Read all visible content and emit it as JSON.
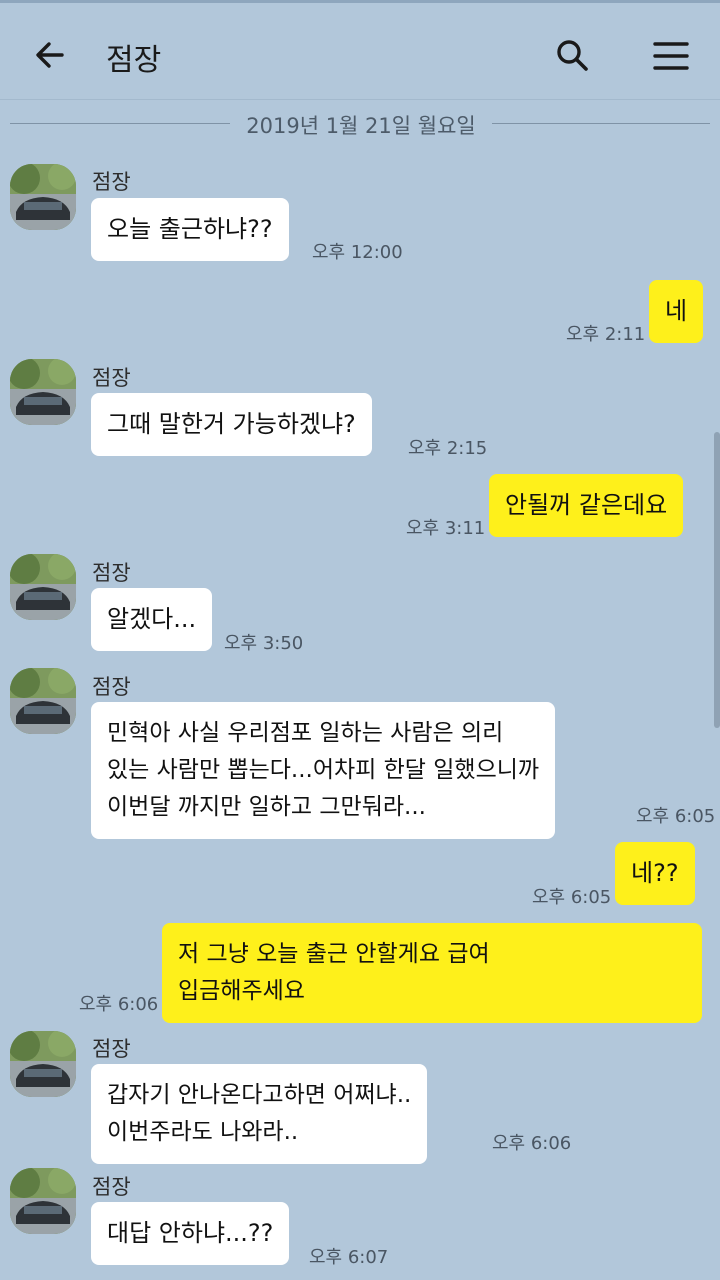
{
  "header": {
    "title": "점장",
    "back_icon": "arrow-left-icon",
    "search_icon": "search-icon",
    "menu_icon": "hamburger-menu-icon"
  },
  "date_divider": "2019년 1월 21일 월요일",
  "colors": {
    "background": "#b2c7da",
    "incoming_bubble": "#ffffff",
    "outgoing_bubble": "#fef01b"
  },
  "messages": [
    {
      "sender": "점장",
      "text": "오늘 출근하냐??",
      "time": "오후 12:00"
    },
    {
      "text": "네",
      "time": "오후 2:11"
    },
    {
      "sender": "점장",
      "text": "그때 말한거 가능하겠냐?",
      "time": "오후 2:15"
    },
    {
      "text": "안될꺼 같은데요",
      "time": "오후 3:11"
    },
    {
      "sender": "점장",
      "text": "알겠다...",
      "time": "오후 3:50"
    },
    {
      "sender": "점장",
      "text": "민혁아 사실 우리점포 일하는 사람은 의리\n있는 사람만 뽑는다...어차피 한달 일했으니까\n이번달 까지만 일하고 그만둬라...",
      "time": "오후 6:05"
    },
    {
      "text": "네??",
      "time": "오후 6:05"
    },
    {
      "text": "저 그냥 오늘 출근 안할게요 급여\n입금해주세요",
      "time": "오후 6:06"
    },
    {
      "sender": "점장",
      "text": "갑자기 안나온다고하면 어쩌냐..\n이번주라도 나와라..",
      "time": "오후 6:06"
    },
    {
      "sender": "점장",
      "text": "대답 안하냐...??",
      "time": "오후 6:07"
    }
  ]
}
